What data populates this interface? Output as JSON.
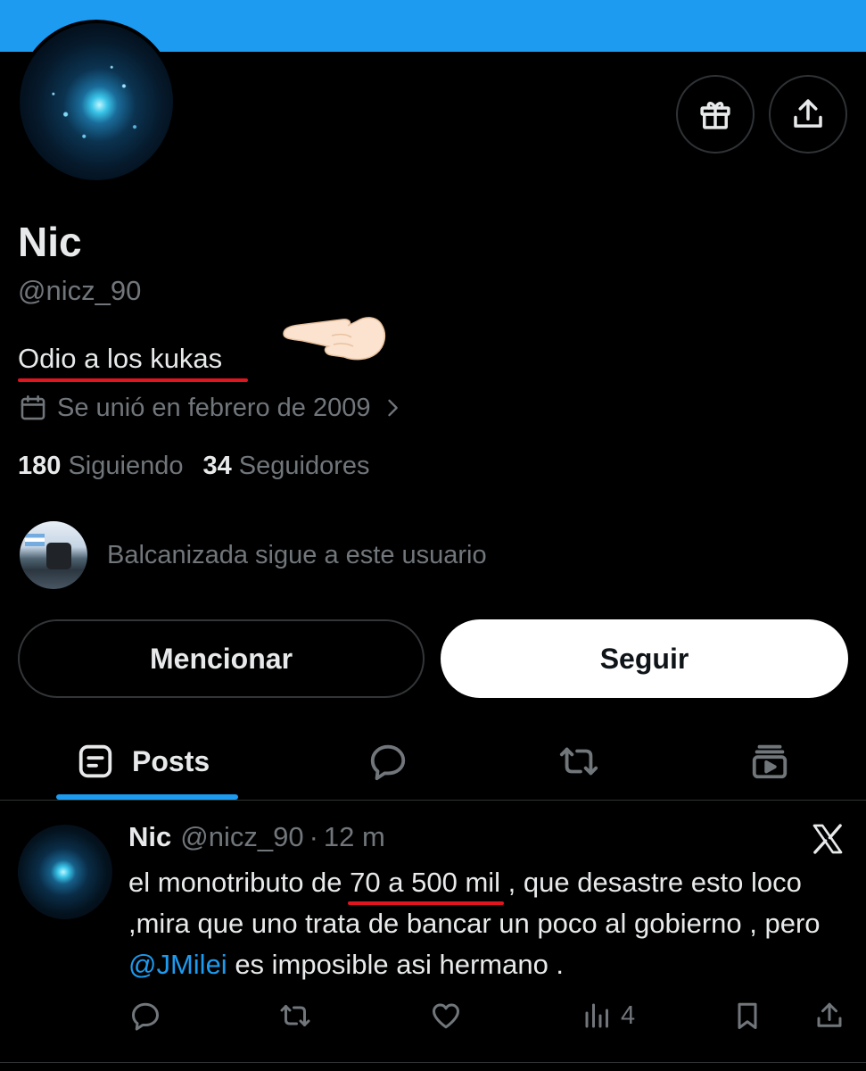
{
  "profile": {
    "name": "Nic",
    "handle": "@nicz_90",
    "bio": "Odio a los kukas",
    "joined": "Se unió en febrero de 2009",
    "following_count": "180",
    "following_label": "Siguiendo",
    "followers_count": "34",
    "followers_label": "Seguidores",
    "followed_by": "Balcanizada sigue a este usuario"
  },
  "buttons": {
    "mention": "Mencionar",
    "follow": "Seguir"
  },
  "tabs": [
    {
      "label": "Posts",
      "icon": "posts-icon",
      "active": true
    },
    {
      "label": "",
      "icon": "replies-icon"
    },
    {
      "label": "",
      "icon": "reposts-icon"
    },
    {
      "label": "",
      "icon": "media-icon"
    }
  ],
  "post": {
    "name": "Nic",
    "handle": "@nicz_90",
    "separator": "·",
    "time": "12 m",
    "text_part1": "el monotributo de ",
    "text_highlight": "70 a 500 mil",
    "text_part2": " , que desastre esto loco ,mira que uno trata de bancar un poco al gobierno , pero ",
    "text_mention": "@JMilei",
    "text_part3": " es imposible asi hermano .",
    "views": "4"
  },
  "colors": {
    "accent": "#1d9bf0",
    "annotation_red": "#e0151e",
    "background": "#000000",
    "secondary_text": "#71767b"
  }
}
